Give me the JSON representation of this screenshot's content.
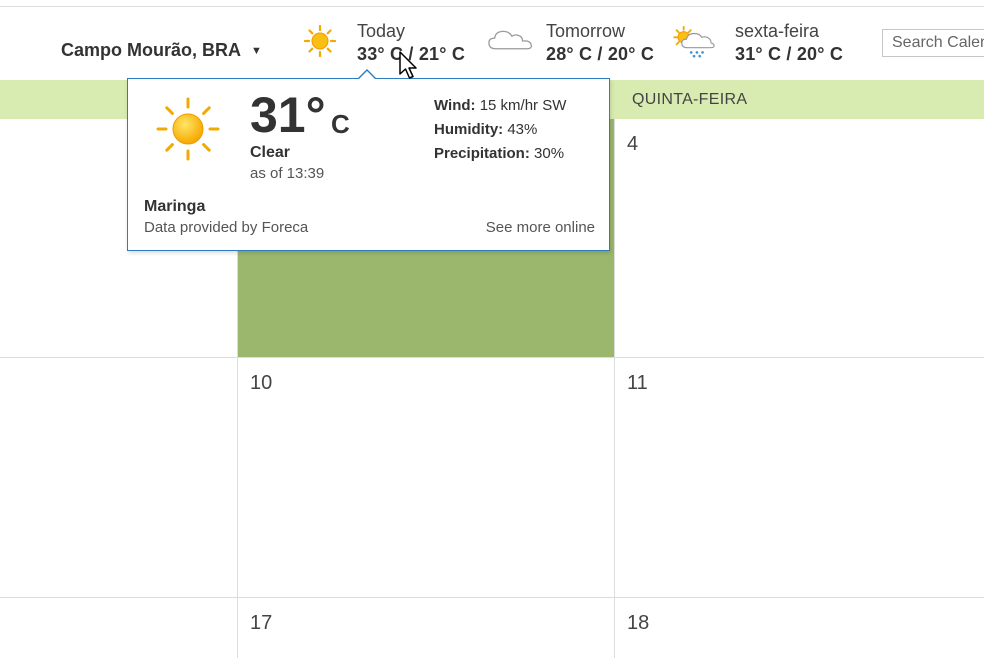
{
  "weather_bar": {
    "location": "Campo Mourão, BRA",
    "forecasts": [
      {
        "day": "Today",
        "temps": "33° C / 21° C",
        "icon": "sun-icon"
      },
      {
        "day": "Tomorrow",
        "temps": "28° C / 20° C",
        "icon": "cloud-icon"
      },
      {
        "day": "sexta-feira",
        "temps": "31° C / 20° C",
        "icon": "sun-cloud-rain-icon"
      }
    ]
  },
  "search": {
    "placeholder": "Search Calendar"
  },
  "calendar": {
    "visible_day_header": "QUINTA-FEIRA",
    "rows": [
      [
        "",
        "",
        "4"
      ],
      [
        "",
        "10",
        "11"
      ],
      [
        "",
        "17",
        "18"
      ]
    ],
    "selected_color": "#9bb76d",
    "header_color": "#d8ecb1"
  },
  "popup": {
    "temperature": "31°",
    "unit": "C",
    "condition": "Clear",
    "as_of": "as of 13:39",
    "wind_label": "Wind:",
    "wind_value": "15 km/hr SW",
    "humidity_label": "Humidity:",
    "humidity_value": "43%",
    "precip_label": "Precipitation:",
    "precip_value": "30%",
    "city": "Maringa",
    "provider": "Data provided by Foreca",
    "more_link": "See more online",
    "icon": "sun-icon",
    "border_color": "#2e7dc3"
  }
}
